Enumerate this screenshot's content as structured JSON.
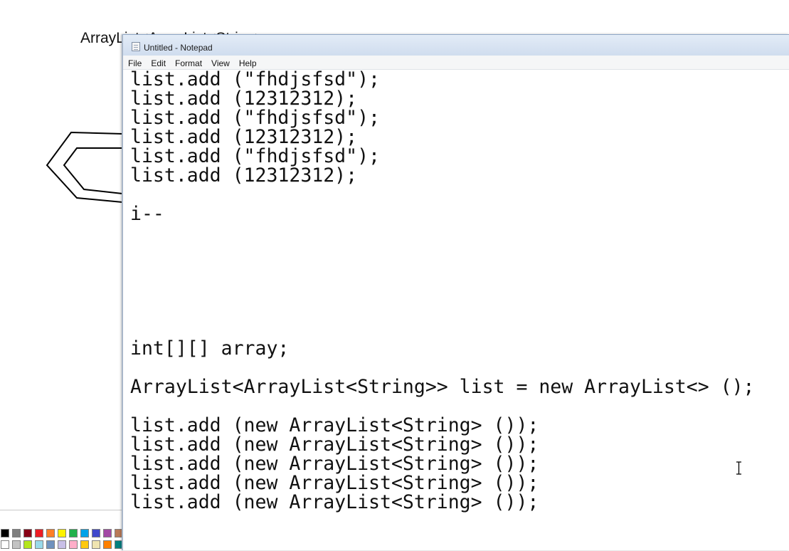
{
  "paint": {
    "background_text": "ArrayList<ArrayList<String>",
    "palette_colors": [
      "#000000",
      "#7f7f7f",
      "#880015",
      "#ed1c24",
      "#ff7f27",
      "#fff200",
      "#22b14c",
      "#00a2e8",
      "#3f48cc",
      "#a349a4",
      "#b97a57",
      "#ffffff",
      "#c3c3c3",
      "#b5e61d",
      "#99d9ea",
      "#7092be",
      "#c8bfe7",
      "#ffaec9",
      "#ffc90e",
      "#efe4b0",
      "#ff8000",
      "#008080"
    ]
  },
  "notepad": {
    "title": "Untitled - Notepad",
    "menu": [
      "File",
      "Edit",
      "Format",
      "View",
      "Help"
    ],
    "content": "list.add (\"fhdjsfsd\");\nlist.add (12312312);\nlist.add (\"fhdjsfsd\");\nlist.add (12312312);\nlist.add (\"fhdjsfsd\");\nlist.add (12312312);\n\ni--\n\n\n\n\n\n\nint[][] array;\n\nArrayList<ArrayList<String>> list = new ArrayList<> ();\n\nlist.add (new ArrayList<String> ());\nlist.add (new ArrayList<String> ());\nlist.add (new ArrayList<String> ());\nlist.add (new ArrayList<String> ());\nlist.add (new ArrayList<String> ());"
  },
  "icons": {
    "app": "notepad-icon",
    "cursor": "text-cursor-icon"
  }
}
